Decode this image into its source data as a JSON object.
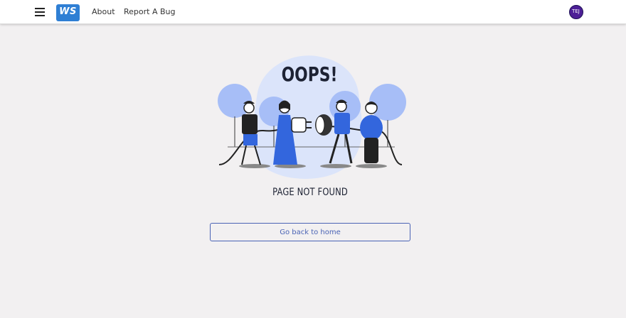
{
  "navbar": {
    "menu_icon": "hamburger-icon",
    "logo_text": "WS",
    "links": [
      "About",
      "Report A Bug"
    ],
    "avatar_initials": "TEJ"
  },
  "error_page": {
    "heading": "OOPS!",
    "message": "PAGE NOT FOUND",
    "button_label": "Go back to home"
  },
  "colors": {
    "brand": "#2f7fd4",
    "accent_blue": "#3366dd",
    "light_blue": "#a7bef7",
    "button_border": "#4a63b5",
    "avatar": "#4d1f96",
    "background": "#f2f0f1"
  }
}
